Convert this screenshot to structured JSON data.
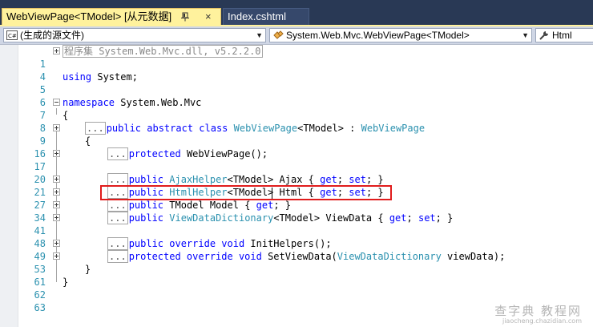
{
  "tabs": {
    "active": {
      "label": "WebViewPage<TModel> [从元数据]",
      "close": "×"
    },
    "inactive": {
      "label": "Index.cshtml"
    }
  },
  "nav": {
    "project": "(生成的源文件)",
    "type": "System.Web.Mvc.WebViewPage<TModel>",
    "member": "Html"
  },
  "code_lines": [
    {
      "num": "1",
      "text": "程序集 System.Web.Mvc.dll, v5.2.2.0"
    },
    {
      "num": "4",
      "text": ""
    },
    {
      "num": "5",
      "text": "using System;"
    },
    {
      "num": "6",
      "text": ""
    },
    {
      "num": "7",
      "text": "namespace System.Web.Mvc"
    },
    {
      "num": "8",
      "text": "{"
    },
    {
      "num": "9",
      "text": "public abstract class WebViewPage<TModel> : WebViewPage"
    },
    {
      "num": "16",
      "text": "{"
    },
    {
      "num": "17",
      "text": "protected WebViewPage();"
    },
    {
      "num": "20",
      "text": ""
    },
    {
      "num": "21",
      "text": "public AjaxHelper<TModel> Ajax { get; set; }"
    },
    {
      "num": "27",
      "text": "public HtmlHelper<TModel> Html { get; set; }"
    },
    {
      "num": "34",
      "text": "public TModel Model { get; }"
    },
    {
      "num": "41",
      "text": "public ViewDataDictionary<TModel> ViewData { get; set; }"
    },
    {
      "num": "48",
      "text": ""
    },
    {
      "num": "49",
      "text": "public override void InitHelpers();"
    },
    {
      "num": "53",
      "text": "protected override void SetViewData(ViewDataDictionary viewData);"
    },
    {
      "num": "61",
      "text": "}"
    },
    {
      "num": "62",
      "text": "}"
    },
    {
      "num": "63",
      "text": ""
    }
  ],
  "collapsed_marker": "...",
  "watermark": {
    "line1": "查字典 教程网",
    "line2": "jiaocheng.chazidian.com"
  },
  "colors": {
    "keyword": "#0000ff",
    "type": "#2b91af",
    "line_number": "#2b91af",
    "tab_bg": "#293955",
    "active_tab": "#fff29d",
    "highlight": "#e01c1c"
  },
  "icons": {
    "pin": "pin-icon",
    "project": "csharp-file-icon",
    "type": "class-icon",
    "member": "wrench-icon"
  }
}
